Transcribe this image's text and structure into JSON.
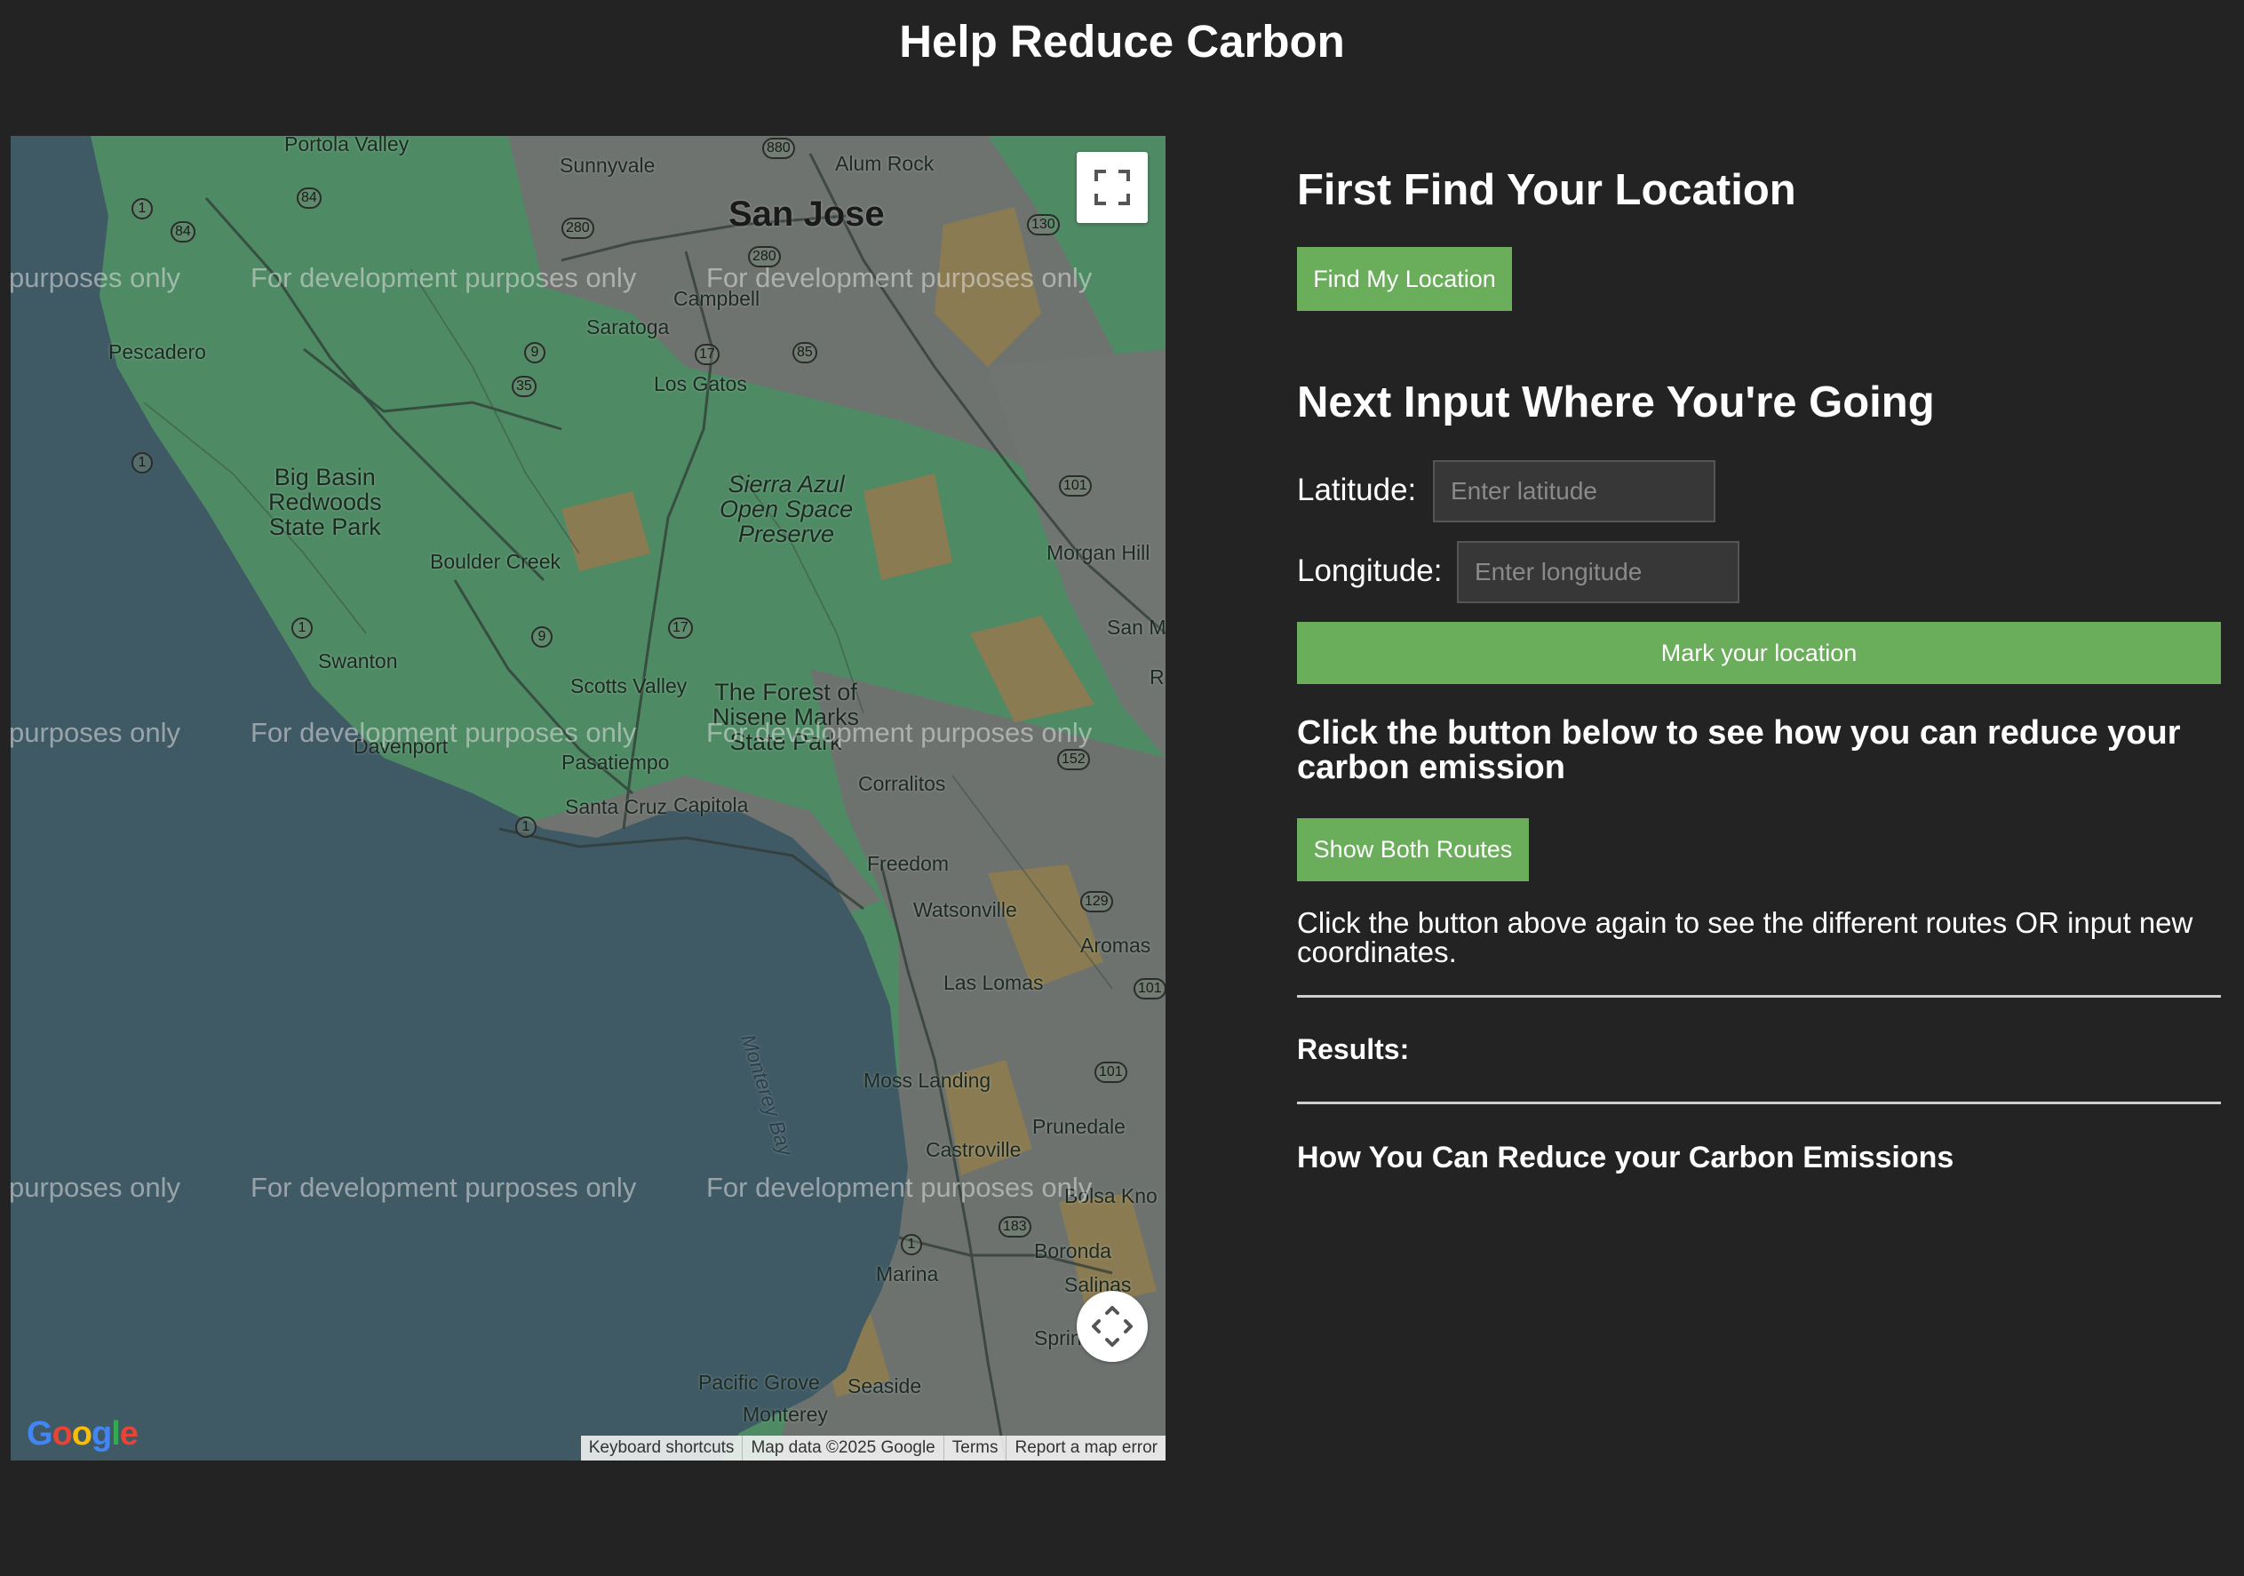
{
  "page": {
    "title": "Help Reduce Carbon"
  },
  "map": {
    "watermark": "For development purposes only",
    "watermark_partial": "purposes only",
    "places": {
      "portola_valley": "Portola Valley",
      "sunnyvale": "Sunnyvale",
      "alum_rock": "Alum Rock",
      "san_jose": "San Jose",
      "campbell": "Campbell",
      "saratoga": "Saratoga",
      "pescadero": "Pescadero",
      "los_gatos": "Los Gatos",
      "big_basin": "Big Basin\nRedwoods\nState Park",
      "sierra_azul": "Sierra Azul\nOpen Space\nPreserve",
      "boulder_creek": "Boulder Creek",
      "morgan_hill": "Morgan Hill",
      "san_m": "San M",
      "swanton": "Swanton",
      "scotts_valley": "Scotts Valley",
      "forest_nisene": "The Forest of\nNisene Marks\nState Park",
      "davenport": "Davenport",
      "pasatiempo": "Pasatiempo",
      "corralitos": "Corralitos",
      "santa_cruz": "Santa Cruz",
      "capitola": "Capitola",
      "freedom": "Freedom",
      "watsonville": "Watsonville",
      "aromas": "Aromas",
      "las_lomas": "Las Lomas",
      "monterey_bay": "Monterey Bay",
      "moss_landing": "Moss Landing",
      "prunedale": "Prunedale",
      "castroville": "Castroville",
      "bolsa_knolls": "Bolsa Kno",
      "boronda": "Boronda",
      "marina": "Marina",
      "salinas": "Salinas",
      "spring": "Sprin",
      "pacific_grove": "Pacific Grove",
      "seaside": "Seaside",
      "monterey": "Monterey",
      "r_cut": "R"
    },
    "highways": [
      "880",
      "84",
      "1",
      "84",
      "280",
      "280",
      "130",
      "9",
      "17",
      "85",
      "35",
      "101",
      "1",
      "9",
      "17",
      "152",
      "1",
      "1",
      "129",
      "101",
      "101",
      "183",
      "1"
    ],
    "logo": "Google",
    "attribution": {
      "keyboard": "Keyboard shortcuts",
      "map_data": "Map data ©2025 Google",
      "terms": "Terms",
      "report": "Report a map error"
    }
  },
  "location": {
    "heading": "First Find Your Location",
    "find_button": "Find My Location"
  },
  "destination": {
    "heading": "Next Input Where You're Going",
    "latitude_label": "Latitude:",
    "latitude_placeholder": "Enter latitude",
    "longitude_label": "Longitude:",
    "longitude_placeholder": "Enter longitude",
    "mark_button": "Mark your location"
  },
  "routes": {
    "heading": "Click the button below to see how you can reduce your carbon emission",
    "show_button": "Show Both Routes",
    "hint": "Click the button above again to see the different routes OR input new coordinates."
  },
  "results": {
    "label": "Results:"
  },
  "reduce": {
    "heading": "How You Can Reduce your Carbon Emissions"
  }
}
